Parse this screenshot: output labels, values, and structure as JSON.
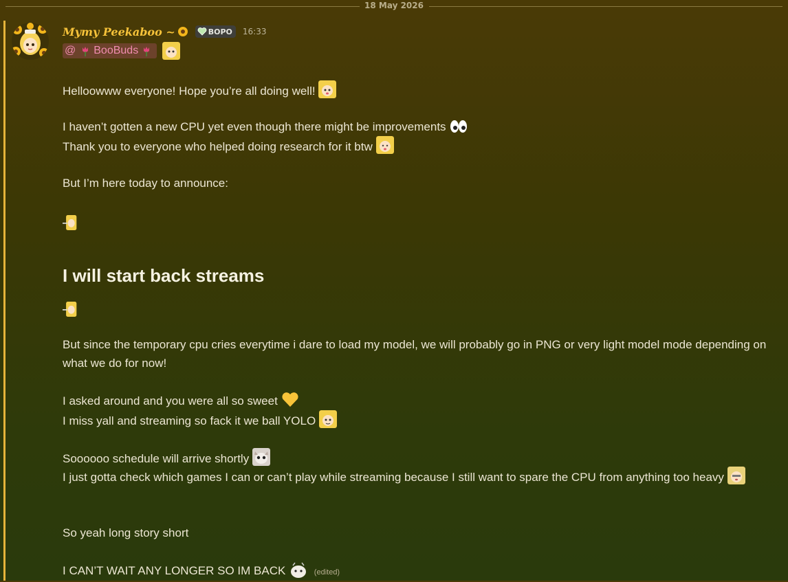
{
  "date_divider": "18 May 2026",
  "author": {
    "username": "Mymy Peekaboo ~",
    "role_tag": "BOPO",
    "timestamp": "16:33"
  },
  "mention": {
    "text": "BooBuds"
  },
  "message": {
    "line1": "Helloowww everyone! Hope you’re all doing well!",
    "line2": "I haven’t gotten a new CPU yet even though there might be improvements",
    "line3": "Thank you to everyone who helped doing research for it btw",
    "line4": "But I’m here today to announce:",
    "heading": "I will start back streams",
    "line5": "But since the temporary cpu cries everytime i dare to load my model, we will probably go in PNG or very light model mode depending on what we do for now!",
    "line6": "I asked around and you were all so sweet",
    "line7": "I miss yall and streaming so fack it we ball YOLO",
    "line8": "Soooooo schedule will arrive shortly",
    "line9": "I just gotta check which games I can or can’t play while streaming because I still want to spare the CPU from anything too heavy",
    "line10": "So yeah long story short",
    "line11": "I CAN’T WAIT ANY LONGER SO IM BACK",
    "edited": "(edited)"
  },
  "icons": [
    "sunflower-avatar",
    "sunflower-icon",
    "green-heart-icon",
    "tulip-icon",
    "chibi-emote",
    "eyes-emoji",
    "yellow-heart-emoji",
    "cat-emote",
    "peeking-emote",
    "blob-emote"
  ],
  "colors": {
    "username": "#f6c23a",
    "accent_bar": "#e5b43a",
    "mention_text": "#f08cb0"
  }
}
